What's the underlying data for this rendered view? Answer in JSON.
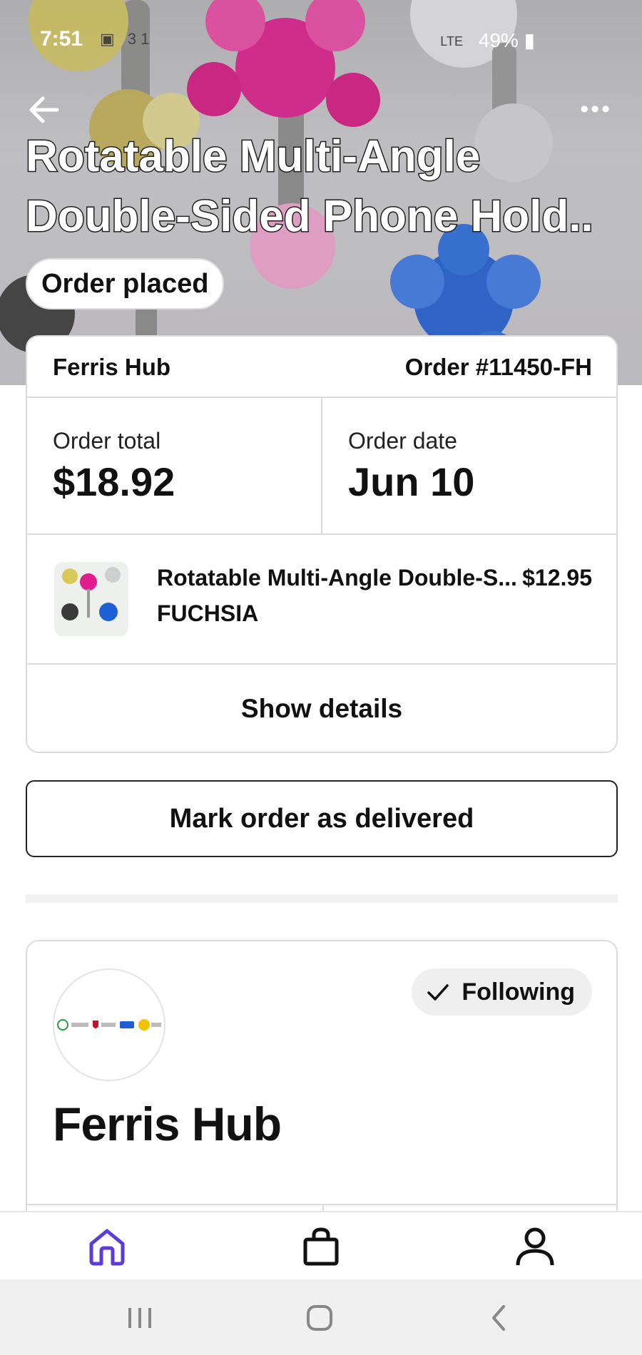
{
  "status_bar": {
    "time": "7:51",
    "icons_left": "▣ 31",
    "network": "LTE",
    "battery": "49%"
  },
  "header": {
    "title_line1": "Rotatable Multi-Angle",
    "title_line2": "Double-Sided Phone Hold..",
    "status_pill": "Order placed"
  },
  "order": {
    "shop_name": "Ferris Hub",
    "order_number": "Order #11450-FH",
    "total_label": "Order total",
    "total_value": "$18.92",
    "date_label": "Order date",
    "date_value": "Jun 10",
    "item": {
      "title": "Rotatable Multi-Angle Double-S...",
      "price": "$12.95",
      "variant": "FUCHSIA"
    },
    "details_label": "Show details"
  },
  "mark_delivered_label": "Mark order as delivered",
  "shop": {
    "name": "Ferris Hub",
    "follow_label": "Following"
  },
  "colors": {
    "accent": "#5b3bdc",
    "hero_bg": "#c7c7ca",
    "pink": "#e21d8e",
    "blue": "#1f5fd6"
  },
  "icons": {
    "back": "arrow-left-icon",
    "more": "more-dots-icon",
    "home": "home-icon",
    "bag": "shopping-bag-icon",
    "profile": "person-icon",
    "check": "check-icon"
  }
}
